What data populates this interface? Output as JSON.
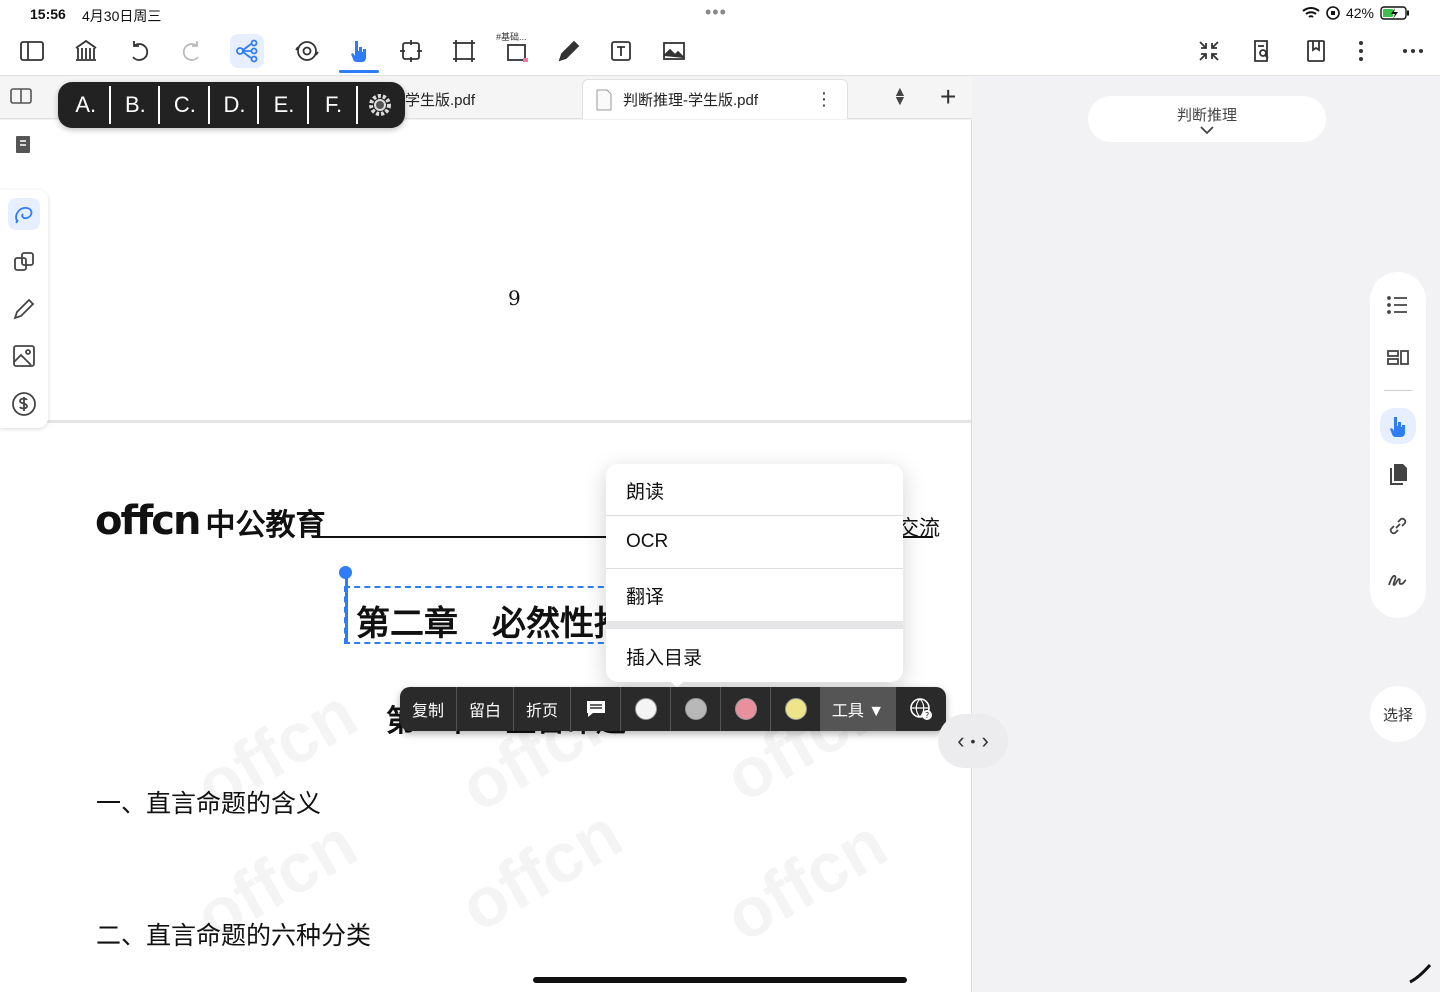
{
  "status": {
    "time": "15:56",
    "date": "4月30日周三",
    "battery": "42%"
  },
  "toolbar": {
    "tag_label": "#基础..."
  },
  "tabs": {
    "tab1_label": "学生版.pdf",
    "tab2_label": "判断推理-学生版.pdf"
  },
  "options": [
    "A.",
    "B.",
    "C.",
    "D.",
    "E.",
    "F."
  ],
  "document": {
    "page_number": "9",
    "logo_text": "中公教育",
    "header_right": "交流",
    "chapter_title": "第二章　必然性推",
    "section_title": "第一节　直言命题",
    "heading1": "一、直言命题的含义",
    "heading2": "二、直言命题的六种分类"
  },
  "popup_menu": [
    "朗读",
    "OCR",
    "翻译",
    "插入目录"
  ],
  "context_bar": {
    "copy": "复制",
    "blank": "留白",
    "fold": "折页",
    "tools": "工具 ▼"
  },
  "colors": {
    "accent": "#2f7df6",
    "highlight_white": "#f4f4f4",
    "highlight_gray": "#b8b8b8",
    "highlight_pink": "#e8909e",
    "highlight_yellow": "#ede58a"
  },
  "right_panel": {
    "doc_selector": "判断推理",
    "select_button": "选择"
  },
  "icons": [
    "sidebar-icon",
    "library-icon",
    "undo-icon",
    "redo-icon",
    "mindmap-icon",
    "sync-icon",
    "hand-pointer-icon",
    "expand-icon",
    "crop-icon",
    "crop-tag-icon",
    "pen-icon",
    "text-box-icon",
    "image-icon",
    "collapse-icon",
    "search-doc-icon",
    "bookmark-icon",
    "more-vertical-icon",
    "more-horizontal-icon"
  ]
}
